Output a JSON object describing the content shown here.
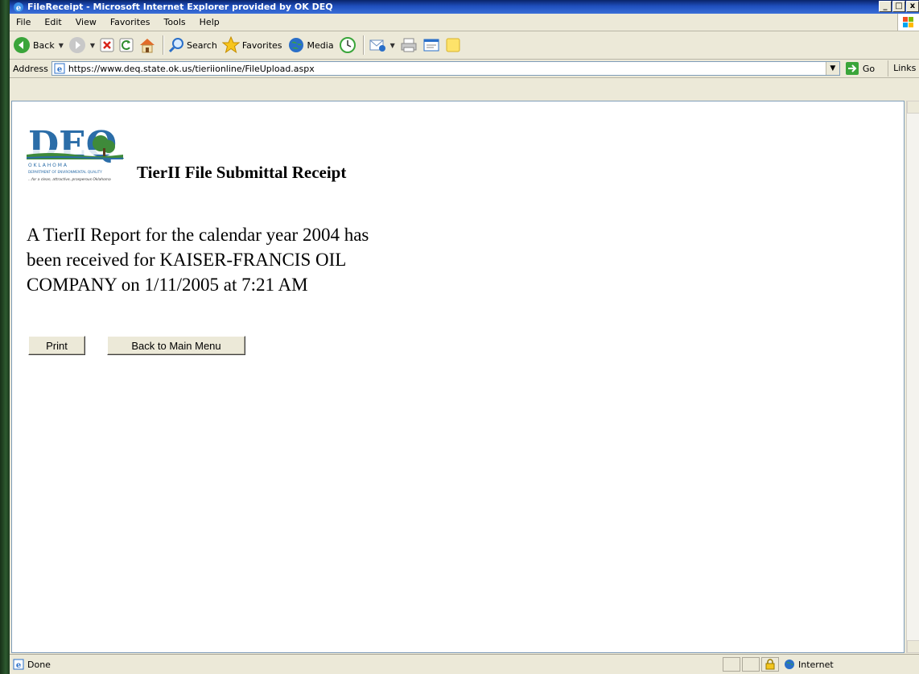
{
  "window": {
    "title": "FileReceipt - Microsoft Internet Explorer provided by OK DEQ",
    "min_label": "_",
    "max_label": "□",
    "close_label": "x"
  },
  "menu": {
    "items": [
      "File",
      "Edit",
      "View",
      "Favorites",
      "Tools",
      "Help"
    ]
  },
  "toolbar": {
    "back_label": "Back",
    "search_label": "Search",
    "favorites_label": "Favorites",
    "media_label": "Media"
  },
  "address": {
    "label": "Address",
    "url": "https://www.deq.state.ok.us/tieriionline/FileUpload.aspx",
    "go_label": "Go",
    "links_label": "Links"
  },
  "page": {
    "logo_text": "DEQ",
    "logo_state": "O K L A H O M A",
    "logo_department": "DEPARTMENT OF ENVIRONMENTAL QUALITY",
    "logo_tagline": "...for a clean, attractive, prosperous Oklahoma",
    "heading": "TierII File Submittal Receipt",
    "message": "A TierII Report for the calendar year 2004 has been received for KAISER-FRANCIS OIL COMPANY on 1/11/2005 at 7:21 AM",
    "print_label": "Print",
    "back_menu_label": "Back to Main Menu"
  },
  "status": {
    "text": "Done",
    "zone": "Internet"
  },
  "colors": {
    "titlebar": "#1f4fbd",
    "chrome": "#ece9d8",
    "logo_blue": "#2b6da8",
    "logo_green": "#3f8a3a"
  }
}
